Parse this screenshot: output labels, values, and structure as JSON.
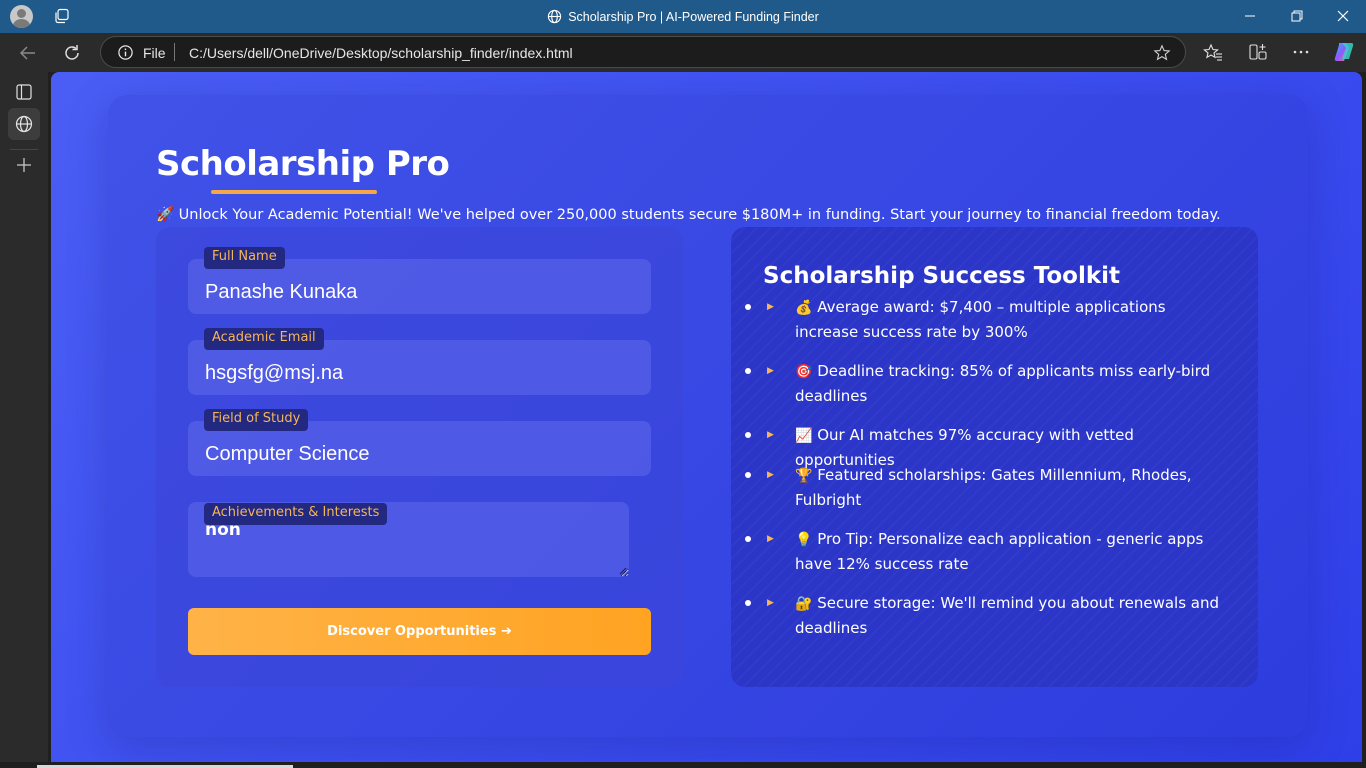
{
  "browser": {
    "window_title": "Scholarship Pro | AI-Powered Funding Finder",
    "url_scheme": "File",
    "url_path": "C:/Users/dell/OneDrive/Desktop/scholarship_finder/index.html"
  },
  "page": {
    "brand": "Scholarship Pro",
    "tagline": "🚀 Unlock Your Academic Potential! We've helped over 250,000 students secure $180M+ in funding. Start your journey to financial freedom today.",
    "accent_color": "#f5a84a"
  },
  "form": {
    "full_name": {
      "label": "Full Name",
      "value": "Panashe Kunaka"
    },
    "email": {
      "label": "Academic Email",
      "value": "hsgsfg@msj.na"
    },
    "field_of_study": {
      "label": "Field of Study",
      "value": "Computer Science"
    },
    "achievements": {
      "label": "Achievements & Interests",
      "value": "non"
    },
    "submit_label": "Discover Opportunities ➔"
  },
  "toolkit": {
    "title": "Scholarship Success Toolkit",
    "arrow_glyph": "▶",
    "tips": [
      {
        "emoji": "💰",
        "text": "Average award: $7,400 – multiple applications increase success rate by 300%"
      },
      {
        "emoji": "🎯",
        "text": "Deadline tracking: 85% of applicants miss early-bird deadlines"
      },
      {
        "emoji": "📈",
        "text": "Our AI matches 97% accuracy with vetted opportunities"
      },
      {
        "emoji": "🏆",
        "text": "Featured scholarships: Gates Millennium, Rhodes, Fulbright"
      },
      {
        "emoji": "💡",
        "text": "Pro Tip: Personalize each application - generic apps have 12% success rate"
      },
      {
        "emoji": "🔐",
        "text": "Secure storage: We'll remind you about renewals and deadlines"
      }
    ]
  }
}
